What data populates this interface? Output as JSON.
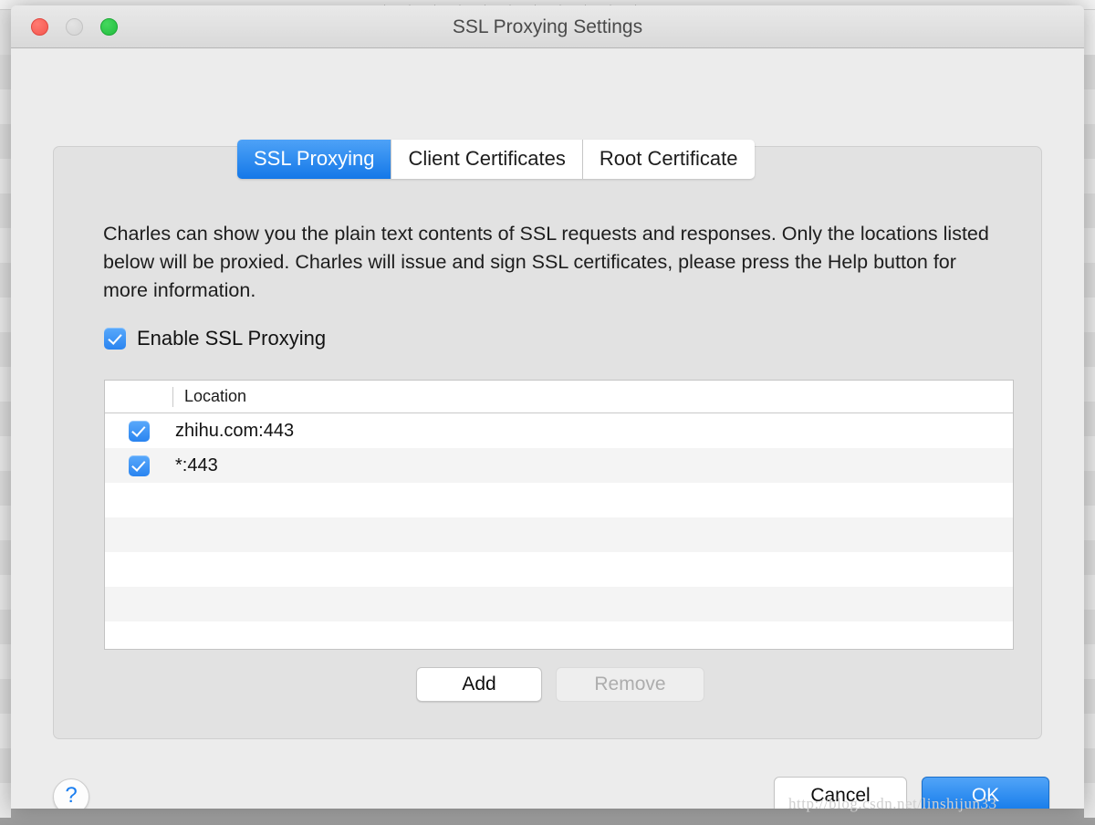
{
  "window": {
    "title": "SSL Proxying Settings",
    "traffic_lights": [
      {
        "name": "close",
        "color": "#f4564e"
      },
      {
        "name": "minimize",
        "color": "#d3d3d3"
      },
      {
        "name": "zoom",
        "color": "#22bd3e"
      }
    ]
  },
  "tabs": [
    {
      "label": "SSL Proxying",
      "active": true
    },
    {
      "label": "Client Certificates",
      "active": false
    },
    {
      "label": "Root Certificate",
      "active": false
    }
  ],
  "description": "Charles can show you the plain text contents of SSL requests and responses. Only the locations listed below will be proxied. Charles will issue and sign SSL certificates, please press the Help button for more information.",
  "enable_checkbox": {
    "label": "Enable SSL Proxying",
    "checked": true,
    "accent": "#2a84f0"
  },
  "table": {
    "columns": [
      "",
      "Location"
    ],
    "rows": [
      {
        "checked": true,
        "location": "zhihu.com:443"
      },
      {
        "checked": true,
        "location": "*:443"
      }
    ],
    "empty_row_count": 6
  },
  "list_buttons": {
    "add": "Add",
    "remove": "Remove",
    "remove_enabled": false
  },
  "footer": {
    "help": "?",
    "cancel": "Cancel",
    "ok": "OK",
    "ok_accent": "#1078e9"
  },
  "watermark": "http://blog.csdn.net/linshijun33",
  "background": {
    "top_text": "· · ·  ·  ·  ·  ·   ·  ·  ·  ·"
  }
}
